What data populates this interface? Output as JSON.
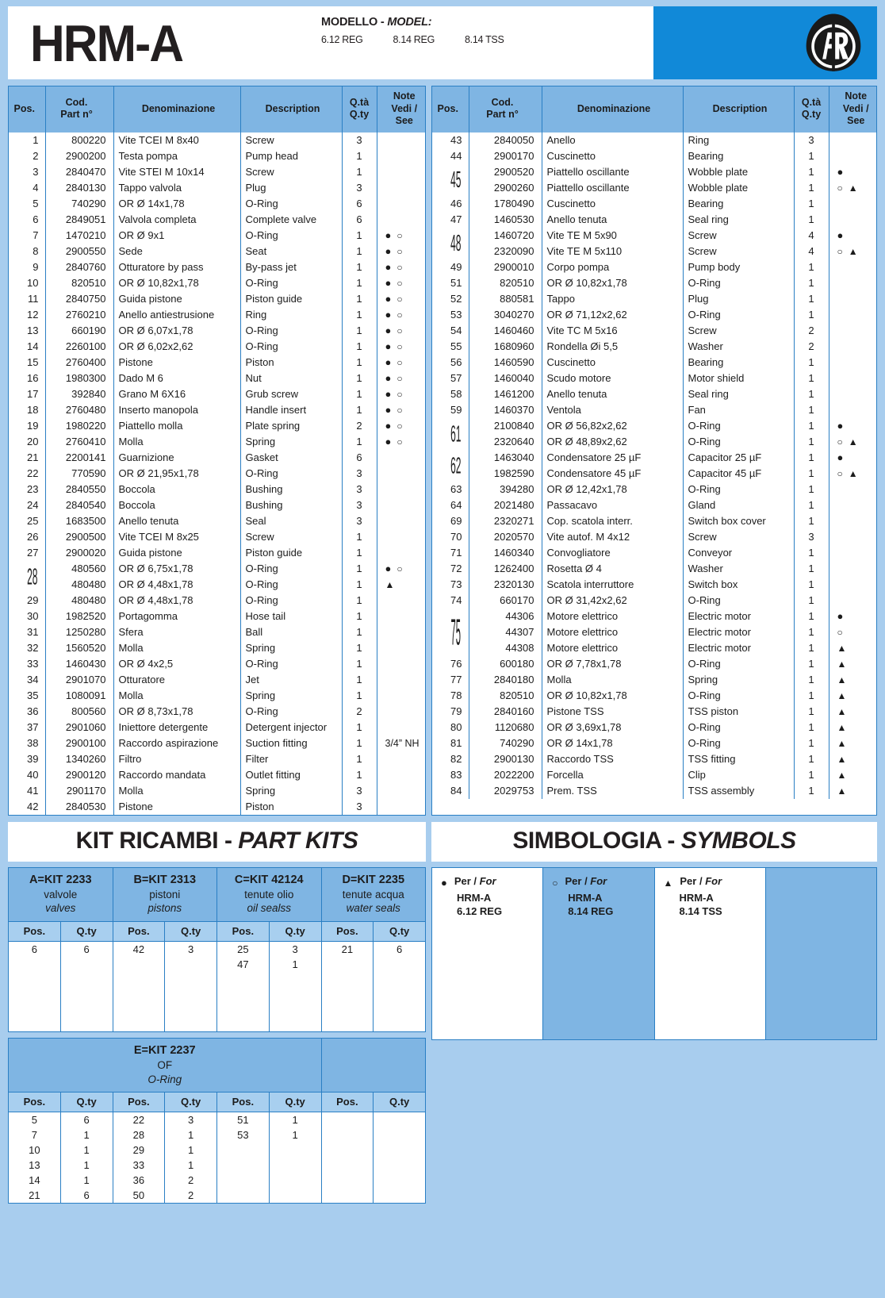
{
  "header": {
    "model_title": "HRM-A",
    "model_label_it": "MODELLO - ",
    "model_label_en": "MODEL:",
    "variants": [
      "6.12 REG",
      "8.14 REG",
      "8.14 TSS"
    ],
    "logo_name": "AR",
    "brand_blue": "#1189d8",
    "header_blue": "#7fb5e3",
    "subheader_blue": "#a8cfef",
    "page_bg": "#a8cdee"
  },
  "table_columns": {
    "pos": "Pos.",
    "cod_l1": "Cod.",
    "cod_l2": "Part n°",
    "denominazione": "Denominazione",
    "description": "Description",
    "qta_l1": "Q.tà",
    "qta_l2": "Q.ty",
    "note_l1": "Note",
    "note_l2": "Vedi / See"
  },
  "left_table": [
    {
      "pos": "1",
      "cod": "800220",
      "den": "Vite TCEI M 8x40",
      "des": "Screw",
      "qty": "3",
      "notes": []
    },
    {
      "pos": "2",
      "cod": "2900200",
      "den": "Testa pompa",
      "des": "Pump head",
      "qty": "1",
      "notes": []
    },
    {
      "pos": "3",
      "cod": "2840470",
      "den": "Vite STEI M 10x14",
      "des": "Screw",
      "qty": "1",
      "notes": []
    },
    {
      "pos": "4",
      "cod": "2840130",
      "den": "Tappo valvola",
      "des": "Plug",
      "qty": "3",
      "notes": []
    },
    {
      "pos": "5",
      "cod": "740290",
      "den": "OR Ø 14x1,78",
      "des": "O-Ring",
      "qty": "6",
      "notes": []
    },
    {
      "pos": "6",
      "cod": "2849051",
      "den": "Valvola completa",
      "des": "Complete valve",
      "qty": "6",
      "notes": []
    },
    {
      "pos": "7",
      "cod": "1470210",
      "den": "OR Ø 9x1",
      "des": "O-Ring",
      "qty": "1",
      "notes": [
        "filled",
        "open"
      ]
    },
    {
      "pos": "8",
      "cod": "2900550",
      "den": "Sede",
      "des": "Seat",
      "qty": "1",
      "notes": [
        "filled",
        "open"
      ]
    },
    {
      "pos": "9",
      "cod": "2840760",
      "den": "Otturatore by pass",
      "des": "By-pass jet",
      "qty": "1",
      "notes": [
        "filled",
        "open"
      ]
    },
    {
      "pos": "10",
      "cod": "820510",
      "den": "OR Ø 10,82x1,78",
      "des": "O-Ring",
      "qty": "1",
      "notes": [
        "filled",
        "open"
      ]
    },
    {
      "pos": "11",
      "cod": "2840750",
      "den": "Guida pistone",
      "des": "Piston guide",
      "qty": "1",
      "notes": [
        "filled",
        "open"
      ]
    },
    {
      "pos": "12",
      "cod": "2760210",
      "den": "Anello antiestrusione",
      "des": "Ring",
      "qty": "1",
      "notes": [
        "filled",
        "open"
      ]
    },
    {
      "pos": "13",
      "cod": "660190",
      "den": "OR Ø 6,07x1,78",
      "des": "O-Ring",
      "qty": "1",
      "notes": [
        "filled",
        "open"
      ]
    },
    {
      "pos": "14",
      "cod": "2260100",
      "den": "OR Ø 6,02x2,62",
      "des": "O-Ring",
      "qty": "1",
      "notes": [
        "filled",
        "open"
      ]
    },
    {
      "pos": "15",
      "cod": "2760400",
      "den": "Pistone",
      "des": "Piston",
      "qty": "1",
      "notes": [
        "filled",
        "open"
      ]
    },
    {
      "pos": "16",
      "cod": "1980300",
      "den": "Dado M 6",
      "des": "Nut",
      "qty": "1",
      "notes": [
        "filled",
        "open"
      ]
    },
    {
      "pos": "17",
      "cod": "392840",
      "den": "Grano M 6X16",
      "des": "Grub screw",
      "qty": "1",
      "notes": [
        "filled",
        "open"
      ]
    },
    {
      "pos": "18",
      "cod": "2760480",
      "den": "Inserto manopola",
      "des": "Handle insert",
      "qty": "1",
      "notes": [
        "filled",
        "open"
      ]
    },
    {
      "pos": "19",
      "cod": "1980220",
      "den": "Piattello molla",
      "des": "Plate spring",
      "qty": "2",
      "notes": [
        "filled",
        "open"
      ]
    },
    {
      "pos": "20",
      "cod": "2760410",
      "den": "Molla",
      "des": "Spring",
      "qty": "1",
      "notes": [
        "filled",
        "open"
      ]
    },
    {
      "pos": "21",
      "cod": "2200141",
      "den": "Guarnizione",
      "des": "Gasket",
      "qty": "6",
      "notes": []
    },
    {
      "pos": "22",
      "cod": "770590",
      "den": "OR Ø 21,95x1,78",
      "des": "O-Ring",
      "qty": "3",
      "notes": []
    },
    {
      "pos": "23",
      "cod": "2840550",
      "den": "Boccola",
      "des": "Bushing",
      "qty": "3",
      "notes": []
    },
    {
      "pos": "24",
      "cod": "2840540",
      "den": "Boccola",
      "des": "Bushing",
      "qty": "3",
      "notes": []
    },
    {
      "pos": "25",
      "cod": "1683500",
      "den": "Anello tenuta",
      "des": "Seal",
      "qty": "3",
      "notes": []
    },
    {
      "pos": "26",
      "cod": "2900500",
      "den": "Vite TCEI M 8x25",
      "des": "Screw",
      "qty": "1",
      "notes": []
    },
    {
      "pos": "27",
      "cod": "2900020",
      "den": "Guida pistone",
      "des": "Piston guide",
      "qty": "1",
      "notes": []
    },
    {
      "pos": "28",
      "merged": 2,
      "cod": "480560",
      "den": "OR Ø 6,75x1,78",
      "des": "O-Ring",
      "qty": "1",
      "notes": [
        "filled",
        "open"
      ]
    },
    {
      "pos": "",
      "cod": "480480",
      "den": "OR Ø 4,48x1,78",
      "des": "O-Ring",
      "qty": "1",
      "notes": [
        "triangle"
      ]
    },
    {
      "pos": "29",
      "cod": "480480",
      "den": "OR Ø 4,48x1,78",
      "des": "O-Ring",
      "qty": "1",
      "notes": []
    },
    {
      "pos": "30",
      "cod": "1982520",
      "den": "Portagomma",
      "des": "Hose tail",
      "qty": "1",
      "notes": []
    },
    {
      "pos": "31",
      "cod": "1250280",
      "den": "Sfera",
      "des": "Ball",
      "qty": "1",
      "notes": []
    },
    {
      "pos": "32",
      "cod": "1560520",
      "den": "Molla",
      "des": "Spring",
      "qty": "1",
      "notes": []
    },
    {
      "pos": "33",
      "cod": "1460430",
      "den": "OR Ø 4x2,5",
      "des": "O-Ring",
      "qty": "1",
      "notes": []
    },
    {
      "pos": "34",
      "cod": "2901070",
      "den": "Otturatore",
      "des": "Jet",
      "qty": "1",
      "notes": []
    },
    {
      "pos": "35",
      "cod": "1080091",
      "den": "Molla",
      "des": "Spring",
      "qty": "1",
      "notes": []
    },
    {
      "pos": "36",
      "cod": "800560",
      "den": "OR Ø 8,73x1,78",
      "des": "O-Ring",
      "qty": "2",
      "notes": []
    },
    {
      "pos": "37",
      "cod": "2901060",
      "den": "Iniettore detergente",
      "des": "Detergent injector",
      "qty": "1",
      "notes": []
    },
    {
      "pos": "38",
      "cod": "2900100",
      "den": "Raccordo aspirazione",
      "des": "Suction fitting",
      "qty": "1",
      "notes": [],
      "note_text": "3/4” NH"
    },
    {
      "pos": "39",
      "cod": "1340260",
      "den": "Filtro",
      "des": "Filter",
      "qty": "1",
      "notes": []
    },
    {
      "pos": "40",
      "cod": "2900120",
      "den": "Raccordo mandata",
      "des": "Outlet fitting",
      "qty": "1",
      "notes": []
    },
    {
      "pos": "41",
      "cod": "2901170",
      "den": "Molla",
      "des": "Spring",
      "qty": "3",
      "notes": []
    },
    {
      "pos": "42",
      "cod": "2840530",
      "den": "Pistone",
      "des": "Piston",
      "qty": "3",
      "notes": []
    }
  ],
  "right_table": [
    {
      "pos": "43",
      "cod": "2840050",
      "den": "Anello",
      "des": "Ring",
      "qty": "3",
      "notes": []
    },
    {
      "pos": "44",
      "cod": "2900170",
      "den": "Cuscinetto",
      "des": "Bearing",
      "qty": "1",
      "notes": []
    },
    {
      "pos": "45",
      "merged": 2,
      "cod": "2900520",
      "den": "Piattello oscillante",
      "des": "Wobble plate",
      "qty": "1",
      "notes": [
        "filled"
      ]
    },
    {
      "pos": "",
      "cod": "2900260",
      "den": "Piattello oscillante",
      "des": "Wobble plate",
      "qty": "1",
      "notes": [
        "open",
        "triangle"
      ]
    },
    {
      "pos": "46",
      "cod": "1780490",
      "den": "Cuscinetto",
      "des": "Bearing",
      "qty": "1",
      "notes": []
    },
    {
      "pos": "47",
      "cod": "1460530",
      "den": "Anello tenuta",
      "des": "Seal ring",
      "qty": "1",
      "notes": []
    },
    {
      "pos": "48",
      "merged": 2,
      "cod": "1460720",
      "den": "Vite TE M 5x90",
      "des": "Screw",
      "qty": "4",
      "notes": [
        "filled"
      ]
    },
    {
      "pos": "",
      "cod": "2320090",
      "den": "Vite TE M 5x110",
      "des": "Screw",
      "qty": "4",
      "notes": [
        "open",
        "triangle"
      ]
    },
    {
      "pos": "49",
      "cod": "2900010",
      "den": "Corpo pompa",
      "des": "Pump body",
      "qty": "1",
      "notes": []
    },
    {
      "pos": "51",
      "cod": "820510",
      "den": "OR Ø 10,82x1,78",
      "des": "O-Ring",
      "qty": "1",
      "notes": []
    },
    {
      "pos": "52",
      "cod": "880581",
      "den": "Tappo",
      "des": "Plug",
      "qty": "1",
      "notes": []
    },
    {
      "pos": "53",
      "cod": "3040270",
      "den": "OR Ø 71,12x2,62",
      "des": "O-Ring",
      "qty": "1",
      "notes": []
    },
    {
      "pos": "54",
      "cod": "1460460",
      "den": "Vite TC M 5x16",
      "des": "Screw",
      "qty": "2",
      "notes": []
    },
    {
      "pos": "55",
      "cod": "1680960",
      "den": "Rondella Øi 5,5",
      "des": "Washer",
      "qty": "2",
      "notes": []
    },
    {
      "pos": "56",
      "cod": "1460590",
      "den": "Cuscinetto",
      "des": "Bearing",
      "qty": "1",
      "notes": []
    },
    {
      "pos": "57",
      "cod": "1460040",
      "den": "Scudo motore",
      "des": "Motor shield",
      "qty": "1",
      "notes": []
    },
    {
      "pos": "58",
      "cod": "1461200",
      "den": "Anello tenuta",
      "des": "Seal ring",
      "qty": "1",
      "notes": []
    },
    {
      "pos": "59",
      "cod": "1460370",
      "den": "Ventola",
      "des": "Fan",
      "qty": "1",
      "notes": []
    },
    {
      "pos": "61",
      "merged": 2,
      "cod": "2100840",
      "den": "OR Ø 56,82x2,62",
      "des": "O-Ring",
      "qty": "1",
      "notes": [
        "filled"
      ]
    },
    {
      "pos": "",
      "cod": "2320640",
      "den": "OR Ø 48,89x2,62",
      "des": "O-Ring",
      "qty": "1",
      "notes": [
        "open",
        "triangle"
      ]
    },
    {
      "pos": "62",
      "merged": 2,
      "cod": "1463040",
      "den": "Condensatore 25 µF",
      "des": "Capacitor 25 µF",
      "qty": "1",
      "notes": [
        "filled"
      ]
    },
    {
      "pos": "",
      "cod": "1982590",
      "den": "Condensatore 45 µF",
      "des": "Capacitor 45 µF",
      "qty": "1",
      "notes": [
        "open",
        "triangle"
      ]
    },
    {
      "pos": "63",
      "cod": "394280",
      "den": "OR Ø 12,42x1,78",
      "des": "O-Ring",
      "qty": "1",
      "notes": []
    },
    {
      "pos": "64",
      "cod": "2021480",
      "den": "Passacavo",
      "des": "Gland",
      "qty": "1",
      "notes": []
    },
    {
      "pos": "69",
      "cod": "2320271",
      "den": "Cop. scatola interr.",
      "des": "Switch box cover",
      "qty": "1",
      "notes": []
    },
    {
      "pos": "70",
      "cod": "2020570",
      "den": "Vite autof. M 4x12",
      "des": "Screw",
      "qty": "3",
      "notes": []
    },
    {
      "pos": "71",
      "cod": "1460340",
      "den": "Convogliatore",
      "des": "Conveyor",
      "qty": "1",
      "notes": []
    },
    {
      "pos": "72",
      "cod": "1262400",
      "den": "Rosetta Ø 4",
      "des": "Washer",
      "qty": "1",
      "notes": []
    },
    {
      "pos": "73",
      "cod": "2320130",
      "den": "Scatola interruttore",
      "des": "Switch box",
      "qty": "1",
      "notes": []
    },
    {
      "pos": "74",
      "cod": "660170",
      "den": "OR Ø 31,42x2,62",
      "des": "O-Ring",
      "qty": "1",
      "notes": []
    },
    {
      "pos": "75",
      "merged": 3,
      "cod": "44306",
      "den": "Motore elettrico",
      "des": "Electric motor",
      "qty": "1",
      "notes": [
        "filled"
      ]
    },
    {
      "pos": "",
      "cod": "44307",
      "den": "Motore elettrico",
      "des": "Electric motor",
      "qty": "1",
      "notes": [
        "open"
      ]
    },
    {
      "pos": "",
      "cod": "44308",
      "den": "Motore elettrico",
      "des": "Electric motor",
      "qty": "1",
      "notes": [
        "triangle"
      ]
    },
    {
      "pos": "76",
      "cod": "600180",
      "den": "OR Ø 7,78x1,78",
      "des": "O-Ring",
      "qty": "1",
      "notes": [
        "triangle"
      ]
    },
    {
      "pos": "77",
      "cod": "2840180",
      "den": "Molla",
      "des": "Spring",
      "qty": "1",
      "notes": [
        "triangle"
      ]
    },
    {
      "pos": "78",
      "cod": "820510",
      "den": "OR Ø 10,82x1,78",
      "des": "O-Ring",
      "qty": "1",
      "notes": [
        "triangle"
      ]
    },
    {
      "pos": "79",
      "cod": "2840160",
      "den": "Pistone TSS",
      "des": "TSS piston",
      "qty": "1",
      "notes": [
        "triangle"
      ]
    },
    {
      "pos": "80",
      "cod": "1120680",
      "den": "OR Ø 3,69x1,78",
      "des": "O-Ring",
      "qty": "1",
      "notes": [
        "triangle"
      ]
    },
    {
      "pos": "81",
      "cod": "740290",
      "den": "OR Ø 14x1,78",
      "des": "O-Ring",
      "qty": "1",
      "notes": [
        "triangle"
      ]
    },
    {
      "pos": "82",
      "cod": "2900130",
      "den": "Raccordo TSS",
      "des": "TSS fitting",
      "qty": "1",
      "notes": [
        "triangle"
      ]
    },
    {
      "pos": "83",
      "cod": "2022200",
      "den": "Forcella",
      "des": "Clip",
      "qty": "1",
      "notes": [
        "triangle"
      ]
    },
    {
      "pos": "84",
      "cod": "2029753",
      "den": "Prem. TSS",
      "des": "TSS assembly",
      "qty": "1",
      "notes": [
        "triangle"
      ]
    }
  ],
  "kit_banner": {
    "it": "KIT RICAMBI - ",
    "en": "PART KITS"
  },
  "symbols_banner": {
    "it": "SIMBOLOGIA - ",
    "en": "SYMBOLS"
  },
  "kit_subheaders": {
    "pos": "Pos.",
    "qty": "Q.ty"
  },
  "kits_row1": [
    {
      "code": "A=KIT 2233",
      "it": "valvole",
      "en": "valves",
      "rows": [
        [
          "6",
          "6"
        ]
      ]
    },
    {
      "code": "B=KIT 2313",
      "it": "pistoni",
      "en": "pistons",
      "rows": [
        [
          "42",
          "3"
        ]
      ]
    },
    {
      "code": "C=KIT 42124",
      "it": "tenute olio",
      "en": "oil sealss",
      "rows": [
        [
          "25",
          "3"
        ],
        [
          "47",
          "1"
        ]
      ]
    },
    {
      "code": "D=KIT 2235",
      "it": "tenute acqua",
      "en": "water seals",
      "rows": [
        [
          "21",
          "6"
        ]
      ]
    }
  ],
  "kit_e": {
    "code": "E=KIT 2237",
    "it": "OF",
    "en": "O-Ring",
    "col1": [
      [
        "5",
        "6"
      ],
      [
        "7",
        "1"
      ],
      [
        "10",
        "1"
      ],
      [
        "13",
        "1"
      ],
      [
        "14",
        "1"
      ],
      [
        "21",
        "6"
      ]
    ],
    "col2": [
      [
        "22",
        "3"
      ],
      [
        "28",
        "1"
      ],
      [
        "29",
        "1"
      ],
      [
        "33",
        "1"
      ],
      [
        "36",
        "2"
      ],
      [
        "50",
        "2"
      ]
    ],
    "col3": [
      [
        "51",
        "1"
      ],
      [
        "53",
        "1"
      ]
    ],
    "col4": []
  },
  "symbols_legend": [
    {
      "glyph": "filled",
      "per": "Per / ",
      "for": "For",
      "model": "HRM-A",
      "variant": "6.12 REG",
      "bg": "white"
    },
    {
      "glyph": "open",
      "per": "Per / ",
      "for": "For",
      "model": "HRM-A",
      "variant": "8.14 REG",
      "bg": "blue"
    },
    {
      "glyph": "triangle",
      "per": "Per / ",
      "for": "For",
      "model": "HRM-A",
      "variant": "8.14 TSS",
      "bg": "white"
    },
    {
      "glyph": "",
      "per": "",
      "for": "",
      "model": "",
      "variant": "",
      "bg": "blue"
    }
  ]
}
